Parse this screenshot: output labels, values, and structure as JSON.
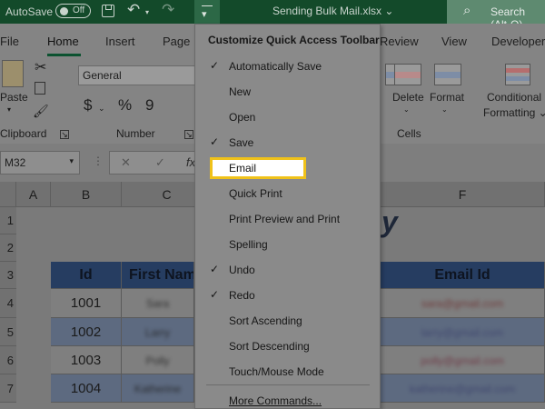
{
  "titlebar": {
    "autosave_label": "AutoSave",
    "autosave_state": "Off",
    "filename": "Sending Bulk Mail.xlsx ⌄",
    "search_placeholder": "Search (Alt-Q)",
    "icons": [
      "save-icon",
      "undo-icon",
      "redo-icon",
      "customize-qat-icon",
      "search-icon"
    ]
  },
  "tabs": [
    "File",
    "Home",
    "Insert",
    "Page",
    "Review",
    "View",
    "Developer"
  ],
  "active_tab": "Home",
  "ribbon": {
    "paste_label": "Paste",
    "clipboard_label": "Clipboard",
    "number_format": "General",
    "number_label": "Number",
    "currency_symbol": "$",
    "percent_symbol": "%",
    "comma_symbol": "9",
    "insert_label": "",
    "delete_label": "Delete",
    "format_label": "Format",
    "cells_label": "Cells",
    "conditional_line1": "Conditional",
    "conditional_line2": "Formatting ⌄"
  },
  "formula_bar": {
    "name_box": "M32",
    "cancel_symbol": "✕",
    "enter_symbol": "✓",
    "fx_symbol": "fx"
  },
  "columns": [
    "A",
    "B",
    "C",
    "F"
  ],
  "rows": [
    "1",
    "2",
    "3",
    "4",
    "5",
    "6",
    "7"
  ],
  "sheet": {
    "title_fragment": "y",
    "headers": {
      "id": "Id",
      "first_name": "First Nam",
      "email": "Email Id"
    },
    "ids": [
      "1001",
      "1002",
      "1003",
      "1004"
    ],
    "first_names": [
      "Sara",
      "Larry",
      "Polly",
      "Katherine"
    ],
    "emails": [
      "sara@gmail.com",
      "larry@gmail.com",
      "polly@gmail.com",
      "katherine@gmail.com"
    ]
  },
  "menu": {
    "title": "Customize Quick Access Toolbar",
    "items": [
      {
        "label": "Automatically Save",
        "checked": true
      },
      {
        "label": "New",
        "checked": false
      },
      {
        "label": "Open",
        "checked": false
      },
      {
        "label": "Save",
        "checked": true
      },
      {
        "label": "Email",
        "checked": false,
        "highlighted": true
      },
      {
        "label": "Quick Print",
        "checked": false
      },
      {
        "label": "Print Preview and Print",
        "checked": false
      },
      {
        "label": "Spelling",
        "checked": false
      },
      {
        "label": "Undo",
        "checked": true
      },
      {
        "label": "Redo",
        "checked": true
      },
      {
        "label": "Sort Ascending",
        "checked": false
      },
      {
        "label": "Sort Descending",
        "checked": false
      },
      {
        "label": "Touch/Mouse Mode",
        "checked": false
      }
    ],
    "more_commands": "More Commands...",
    "check_glyph": "✓",
    "highlight_color": "#f0c21a"
  }
}
